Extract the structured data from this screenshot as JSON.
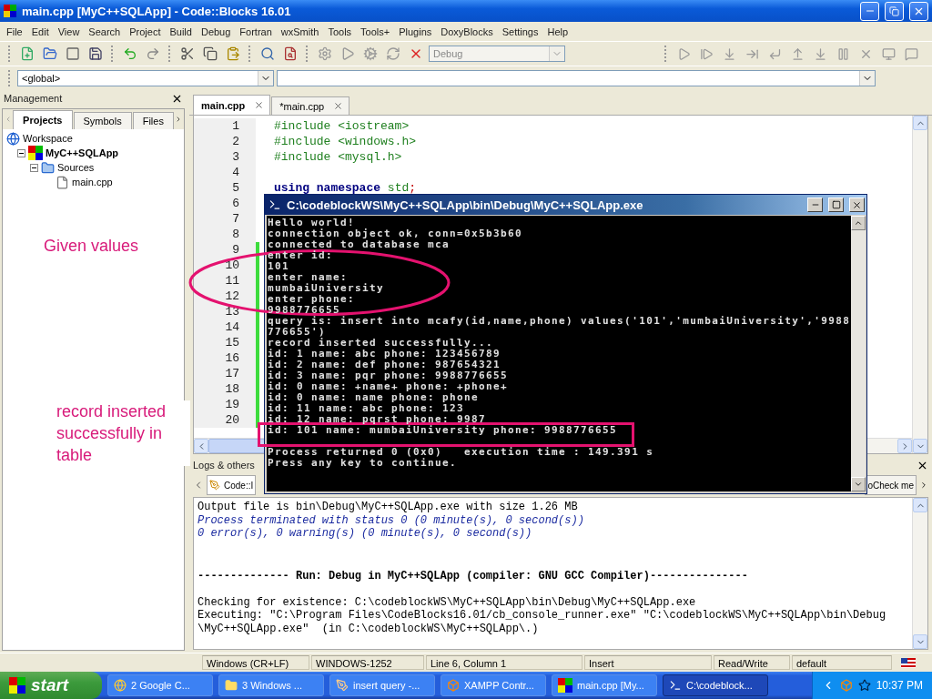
{
  "window": {
    "title": "main.cpp [MyC++SQLApp] - Code::Blocks 16.01"
  },
  "menu": [
    "File",
    "Edit",
    "View",
    "Search",
    "Project",
    "Build",
    "Debug",
    "Fortran",
    "wxSmith",
    "Tools",
    "Tools+",
    "Plugins",
    "DoxyBlocks",
    "Settings",
    "Help"
  ],
  "toolbar": {
    "build_target": "Debug"
  },
  "scope_bar": {
    "scope": "<global>"
  },
  "management": {
    "title": "Management",
    "tabs": [
      {
        "label": "Projects",
        "selected": true
      },
      {
        "label": "Symbols",
        "selected": false
      },
      {
        "label": "Files",
        "selected": false
      }
    ],
    "tree": [
      {
        "label": "Workspace",
        "kind": "workspace",
        "children": [
          {
            "label": "MyC++SQLApp",
            "kind": "project",
            "expanded": true,
            "children": [
              {
                "label": "Sources",
                "kind": "folder",
                "expanded": true,
                "children": [
                  {
                    "label": "main.cpp",
                    "kind": "file"
                  }
                ]
              }
            ]
          }
        ]
      }
    ]
  },
  "editor": {
    "tabs": [
      {
        "label": "main.cpp",
        "selected": true
      },
      {
        "label": "*main.cpp",
        "selected": false
      }
    ],
    "lines": [
      {
        "number": "1",
        "changed": false,
        "tokens": [
          {
            "text": "#include <iostream>",
            "kind": "preprocessor"
          }
        ]
      },
      {
        "number": "2",
        "changed": false,
        "tokens": [
          {
            "text": "#include <windows.h>",
            "kind": "preprocessor"
          }
        ]
      },
      {
        "number": "3",
        "changed": false,
        "tokens": [
          {
            "text": "#include <mysql.h>",
            "kind": "preprocessor"
          }
        ]
      },
      {
        "number": "4",
        "changed": false
      },
      {
        "number": "5",
        "changed": false,
        "tokens": [
          {
            "text": "using namespace ",
            "kind": "keyword"
          },
          {
            "text": "std",
            "kind": "name"
          },
          {
            "text": ";",
            "kind": "operator"
          }
        ]
      },
      {
        "number": "6",
        "changed": false
      },
      {
        "number": "7",
        "changed": false
      },
      {
        "number": "8",
        "changed": false
      },
      {
        "number": "9",
        "changed": true
      },
      {
        "number": "10",
        "changed": true
      },
      {
        "number": "11",
        "changed": true
      },
      {
        "number": "12",
        "changed": true
      },
      {
        "number": "13",
        "changed": true
      },
      {
        "number": "14",
        "changed": true
      },
      {
        "number": "15",
        "changed": true
      },
      {
        "number": "16",
        "changed": true
      },
      {
        "number": "17",
        "changed": true
      },
      {
        "number": "18",
        "changed": true
      },
      {
        "number": "19",
        "changed": true
      },
      {
        "number": "20",
        "changed": true
      }
    ]
  },
  "console": {
    "title": "C:\\codeblockWS\\MyC++SQLApp\\bin\\Debug\\MyC++SQLApp.exe",
    "lines": [
      {
        "kind": "text",
        "text": "Hello world!"
      },
      {
        "kind": "text",
        "text": "connection object ok, conn=0x5b3b60"
      },
      {
        "kind": "text",
        "text": "connected to database mca"
      },
      {
        "kind": "text",
        "text": "enter id:"
      },
      {
        "kind": "text",
        "text": "101"
      },
      {
        "kind": "text",
        "text": "enter name:"
      },
      {
        "kind": "text",
        "text": "mumbaiUniversity"
      },
      {
        "kind": "text",
        "text": "enter phone:"
      },
      {
        "kind": "text",
        "text": "9988776655"
      },
      {
        "kind": "text",
        "text": "query is: insert into mcafy(id,name,phone) values('101','mumbaiUniversity','9988"
      },
      {
        "kind": "text",
        "text": "776655')"
      },
      {
        "kind": "text",
        "text": "record inserted successfully..."
      },
      {
        "kind": "text",
        "text": "id: 1 name: abc phone: 123456789"
      },
      {
        "kind": "text",
        "text": "id: 2 name: def phone: 987654321"
      },
      {
        "kind": "text",
        "text": "id: 3 name: pqr phone: 9988776655"
      },
      {
        "kind": "text",
        "text": "id: 0 name: +name+ phone: +phone+"
      },
      {
        "kind": "text",
        "text": "id: 0 name: name phone: phone"
      },
      {
        "kind": "text",
        "text": "id: 11 name: abc phone: 123"
      },
      {
        "kind": "text",
        "text": "id: 12 name: pqrst phone: 9987"
      },
      {
        "kind": "text",
        "text": "id: 101 name: mumbaiUniversity phone: 9988776655"
      },
      {
        "kind": "blank"
      },
      {
        "kind": "text",
        "text": "Process returned 0 (0x0)   execution time : 149.391 s"
      },
      {
        "kind": "text",
        "text": "Press any key to continue."
      }
    ]
  },
  "annotations": [
    {
      "kind": "ellipse",
      "label": "Given values"
    },
    {
      "kind": "frame",
      "label": "record inserted successfully in table"
    }
  ],
  "logs": {
    "title": "Logs & others",
    "tabs": [
      {
        "label": "Code::I",
        "selected": true
      },
      {
        "label": "oCheck me",
        "selected": false
      }
    ],
    "lines": [
      {
        "kind": "plain",
        "text": "Output file is bin\\Debug\\MyC++SQLApp.exe with size 1.26 MB"
      },
      {
        "kind": "info",
        "text": "Process terminated with status 0 (0 minute(s), 0 second(s))"
      },
      {
        "kind": "info",
        "text": "0 error(s), 0 warning(s) (0 minute(s), 0 second(s))"
      },
      {
        "kind": "blank"
      },
      {
        "kind": "blank"
      },
      {
        "kind": "heading",
        "text": "-------------- Run: Debug in MyC++SQLApp (compiler: GNU GCC Compiler)---------------"
      },
      {
        "kind": "blank"
      },
      {
        "kind": "plain",
        "text": "Checking for existence: C:\\codeblockWS\\MyC++SQLApp\\bin\\Debug\\MyC++SQLApp.exe"
      },
      {
        "kind": "plain",
        "text": "Executing: \"C:\\Program Files\\CodeBlocks16.01/cb_console_runner.exe\" \"C:\\codeblockWS\\MyC++SQLApp\\bin\\Debug"
      },
      {
        "kind": "plain",
        "text": "\\MyC++SQLApp.exe\"  (in C:\\codeblockWS\\MyC++SQLApp\\.)"
      }
    ]
  },
  "status_bar": [
    "Windows (CR+LF)",
    "WINDOWS-1252",
    "Line 6, Column 1",
    "Insert",
    "Read/Write",
    "default"
  ],
  "taskbar": {
    "start": "start",
    "clock": "10:37 PM",
    "items": [
      {
        "label": "2 Google C...",
        "kind": "browser",
        "selected": false
      },
      {
        "label": "3 Windows ...",
        "kind": "folder",
        "selected": false
      },
      {
        "label": "insert query -...",
        "kind": "editor",
        "selected": false
      },
      {
        "label": "XAMPP Contr...",
        "kind": "xampp",
        "selected": false
      },
      {
        "label": "main.cpp [My...",
        "kind": "ide",
        "selected": false
      },
      {
        "label": "C:\\codeblock...",
        "kind": "console",
        "selected": true
      }
    ]
  }
}
